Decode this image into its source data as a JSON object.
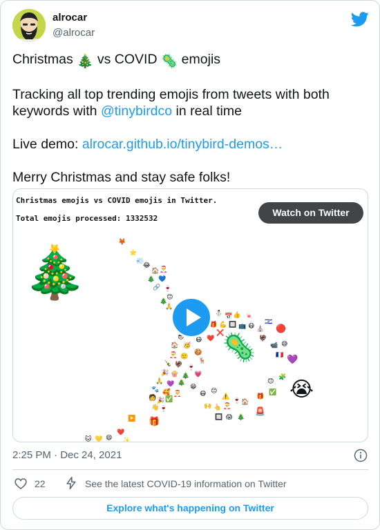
{
  "author": {
    "name": "alrocar",
    "handle": "@alrocar",
    "avatar_icon": "bearded-man-avatar",
    "brand_icon": "twitter-bird-icon"
  },
  "tweet": {
    "line1_a": "Christmas ",
    "line1_emoji_a": "🎄",
    "line1_b": " vs COVID ",
    "line1_emoji_b": "🦠",
    "line1_c": " emojis",
    "line2": "Tracking all top trending emojis from tweets with both keywords with ",
    "mention": "@tinybirdco",
    "line2_end": " in real time",
    "live_demo_label": "Live demo: ",
    "live_demo_link": "alrocar.github.io/tinybird-demos…",
    "closing": "Merry Christmas and stay safe folks!"
  },
  "media": {
    "heading": "Christmas emojis vs COVID emojis in Twitter.",
    "processed": "Total emojis processed: 1332532",
    "watch_label": "Watch on Twitter",
    "play_icon": "play-icon",
    "tree_emoji": "🎄",
    "virus_emoji": "🦠",
    "crying_emoji": "😭"
  },
  "footer": {
    "timestamp": "2:25 PM · Dec 24, 2021",
    "like_count": "22",
    "covid_info": "See the latest COVID-19 information on Twitter",
    "explore_label": "Explore what's happening on Twitter",
    "info_icon": "info-icon",
    "heart_icon": "heart-icon",
    "bolt_icon": "bolt-icon"
  },
  "colors": {
    "link": "#1d9bf0",
    "secondary_text": "#536471",
    "border": "#cfd9de",
    "avatar_bg": "#c6d64a"
  }
}
